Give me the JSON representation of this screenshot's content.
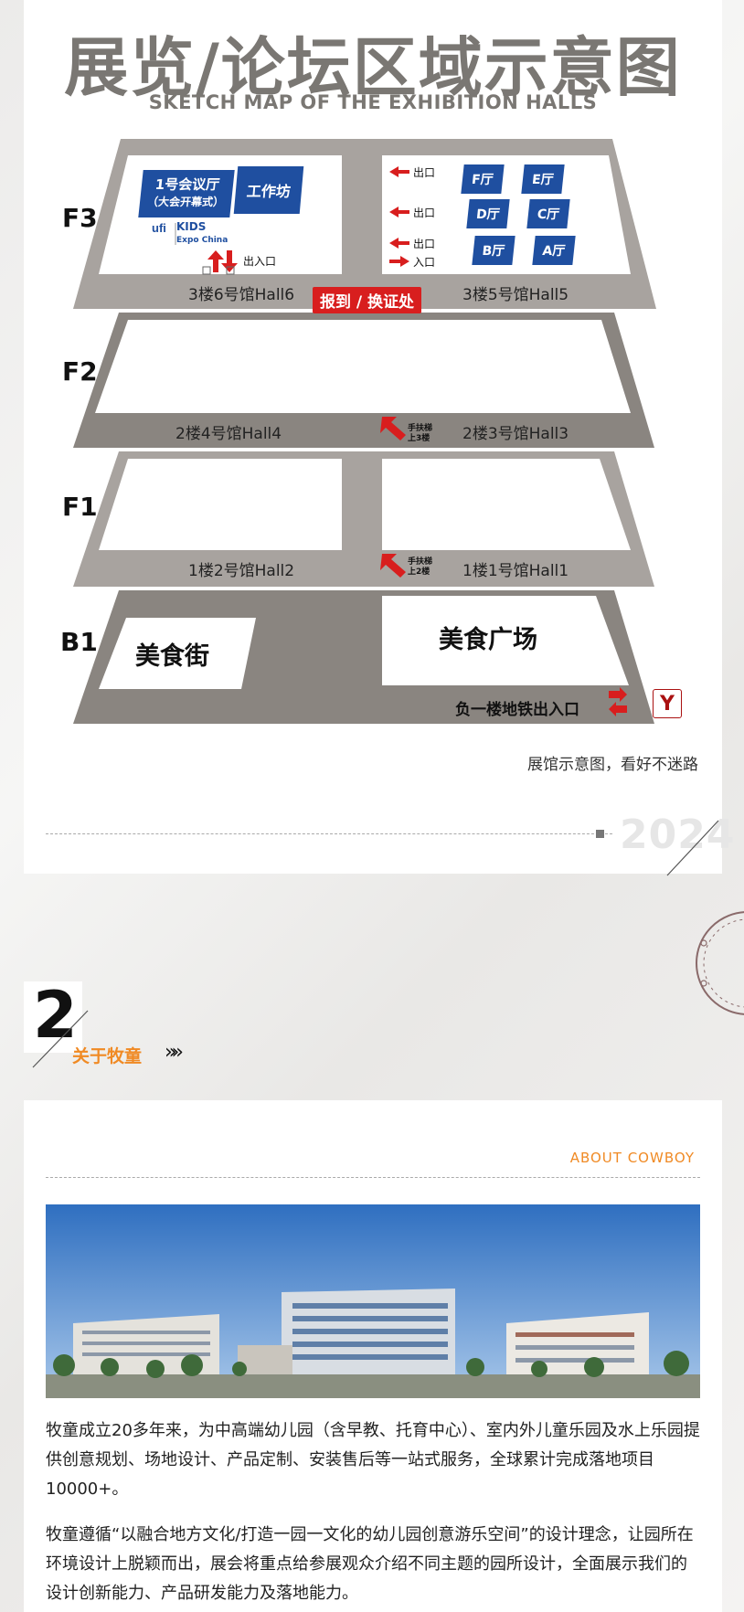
{
  "map": {
    "title": "展览/论坛区域示意图",
    "subtitle": "SKETCH MAP OF THE EXHIBITION HALLS",
    "floors": {
      "f3": "F3",
      "f2": "F2",
      "f1": "F1",
      "b1": "B1"
    },
    "f3": {
      "hall6": "3楼6号馆Hall6",
      "hall5": "3楼5号馆Hall5",
      "meeting_room_line1": "1号会议厅",
      "meeting_room_line2": "（大会开幕式）",
      "workshop": "工作坊",
      "exit_entrance": "出入口",
      "registration": "报到 / 换证处",
      "rooms": [
        "F厅",
        "E厅",
        "D厅",
        "C厅",
        "B厅",
        "A厅"
      ],
      "side_labels": [
        "出口",
        "出口",
        "出口",
        "入口"
      ],
      "logo_ufi": "ufi",
      "logo_kids_1": "KIDS",
      "logo_kids_2": "Expo China"
    },
    "f2": {
      "hall4": "2楼4号馆Hall4",
      "hall3": "2楼3号馆Hall3",
      "escalator_line1": "手扶梯",
      "escalator_line2": "上3楼"
    },
    "f1": {
      "hall2": "1楼2号馆Hall2",
      "hall1": "1楼1号馆Hall1",
      "escalator_line1": "手扶梯",
      "escalator_line2": "上2楼"
    },
    "b1": {
      "food_street": "美食街",
      "food_plaza": "美食广场",
      "metro_exit": "负一楼地铁出入口",
      "metro_icon": "Y"
    },
    "caption": "展馆示意图，看好不迷路",
    "year": "2024"
  },
  "section2": {
    "number": "2",
    "title": "关于牧童",
    "chevrons": "»»",
    "subtitle_en": "ABOUT COWBOY",
    "paragraphs": [
      "牧童成立20多年来，为中高端幼儿园（含早教、托育中心）、室内外儿童乐园及水上乐园提供创意规划、场地设计、产品定制、安装售后等一站式服务，全球累计完成落地项目10000+。",
      "牧童遵循“以融合地方文化/打造一园一文化的幼儿园创意游乐空间”的设计理念，让园所在环境设计上脱颖而出，展会将重点给参展观众介绍不同主题的园所设计，全面展示我们的设计创新能力、产品研发能力及落地能力。"
    ]
  },
  "colors": {
    "accent_orange": "#f08a24",
    "map_gray": "#a8a39f",
    "map_dark_gray": "#8a8580",
    "room_blue": "#1f4fa0",
    "badge_red": "#d81e1e"
  }
}
